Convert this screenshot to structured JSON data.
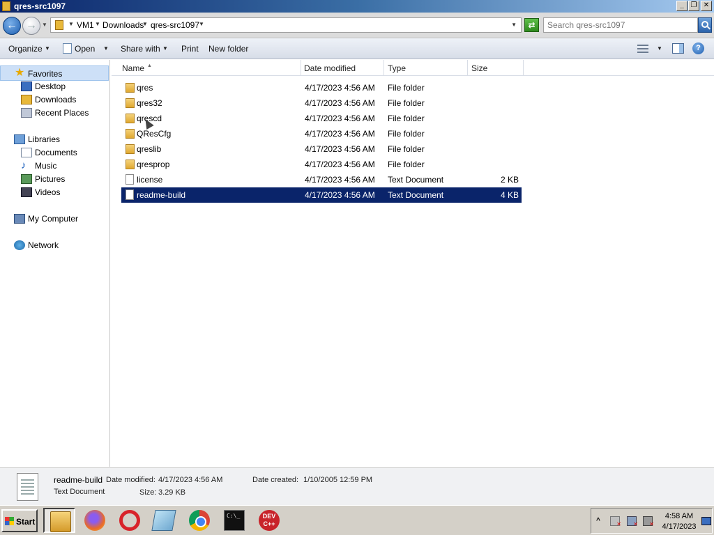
{
  "window": {
    "title": "qres-src1097",
    "minimize": "_",
    "maximize": "❐",
    "close": "✕"
  },
  "address": {
    "crumbs": [
      "VM1",
      "Downloads",
      "qres-src1097"
    ],
    "search_placeholder": "Search qres-src1097"
  },
  "toolbar": {
    "organize": "Organize",
    "open": "Open",
    "share_with": "Share with",
    "print": "Print",
    "new_folder": "New folder"
  },
  "nav": {
    "favorites": "Favorites",
    "favorites_items": [
      "Desktop",
      "Downloads",
      "Recent Places"
    ],
    "libraries": "Libraries",
    "libraries_items": [
      "Documents",
      "Music",
      "Pictures",
      "Videos"
    ],
    "computer": "My Computer",
    "network": "Network"
  },
  "columns": {
    "name": "Name",
    "date_modified": "Date modified",
    "type": "Type",
    "size": "Size"
  },
  "files": [
    {
      "name": "qres",
      "date": "4/17/2023 4:56 AM",
      "type": "File folder",
      "size": "",
      "kind": "folder"
    },
    {
      "name": "qres32",
      "date": "4/17/2023 4:56 AM",
      "type": "File folder",
      "size": "",
      "kind": "folder"
    },
    {
      "name": "qrescd",
      "date": "4/17/2023 4:56 AM",
      "type": "File folder",
      "size": "",
      "kind": "folder"
    },
    {
      "name": "QResCfg",
      "date": "4/17/2023 4:56 AM",
      "type": "File folder",
      "size": "",
      "kind": "folder"
    },
    {
      "name": "qreslib",
      "date": "4/17/2023 4:56 AM",
      "type": "File folder",
      "size": "",
      "kind": "folder"
    },
    {
      "name": "qresprop",
      "date": "4/17/2023 4:56 AM",
      "type": "File folder",
      "size": "",
      "kind": "folder"
    },
    {
      "name": "license",
      "date": "4/17/2023 4:56 AM",
      "type": "Text Document",
      "size": "2 KB",
      "kind": "file"
    },
    {
      "name": "readme-build",
      "date": "4/17/2023 4:56 AM",
      "type": "Text Document",
      "size": "4 KB",
      "kind": "file",
      "selected": true
    }
  ],
  "details": {
    "name": "readme-build",
    "type": "Text Document",
    "modified_label": "Date modified:",
    "modified_value": "4/17/2023 4:56 AM",
    "created_label": "Date created:",
    "created_value": "1/10/2005 12:59 PM",
    "size_label": "Size:",
    "size_value": "3.29 KB"
  },
  "taskbar": {
    "start": "Start",
    "apps": [
      "file-explorer-icon",
      "firefox-icon",
      "opera-icon",
      "notepad-icon",
      "chrome-icon",
      "command-prompt-icon",
      "dev-cpp-icon"
    ],
    "cmd_text": "C:\\_",
    "devcpp_text": "DEV C++",
    "clock_time": "4:58 AM",
    "clock_date": "4/17/2023"
  }
}
